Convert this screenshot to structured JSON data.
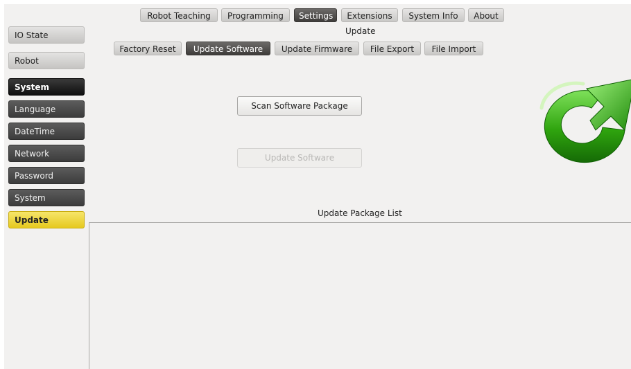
{
  "top_tabs": [
    {
      "label": "Robot Teaching",
      "active": false
    },
    {
      "label": "Programming",
      "active": false
    },
    {
      "label": "Settings",
      "active": true
    },
    {
      "label": "Extensions",
      "active": false
    },
    {
      "label": "System Info",
      "active": false
    },
    {
      "label": "About",
      "active": false
    }
  ],
  "section_title": "Update",
  "sub_tabs": [
    {
      "label": "Factory Reset",
      "active": false
    },
    {
      "label": "Update Software",
      "active": true
    },
    {
      "label": "Update Firmware",
      "active": false
    },
    {
      "label": "File Export",
      "active": false
    },
    {
      "label": "File Import",
      "active": false
    }
  ],
  "sidebar": {
    "items": [
      {
        "label": "IO State"
      },
      {
        "label": "Robot"
      },
      {
        "label": "System"
      },
      {
        "label": "Language"
      },
      {
        "label": "DateTime"
      },
      {
        "label": "Network"
      },
      {
        "label": "Password"
      },
      {
        "label": "System"
      },
      {
        "label": "Update"
      }
    ]
  },
  "main": {
    "scan_button": "Scan Software  Package",
    "update_button": "Update Software",
    "list_title": "Update Package List",
    "packages": []
  },
  "icon": {
    "name": "refresh-icon",
    "color": "#2fa40e"
  }
}
